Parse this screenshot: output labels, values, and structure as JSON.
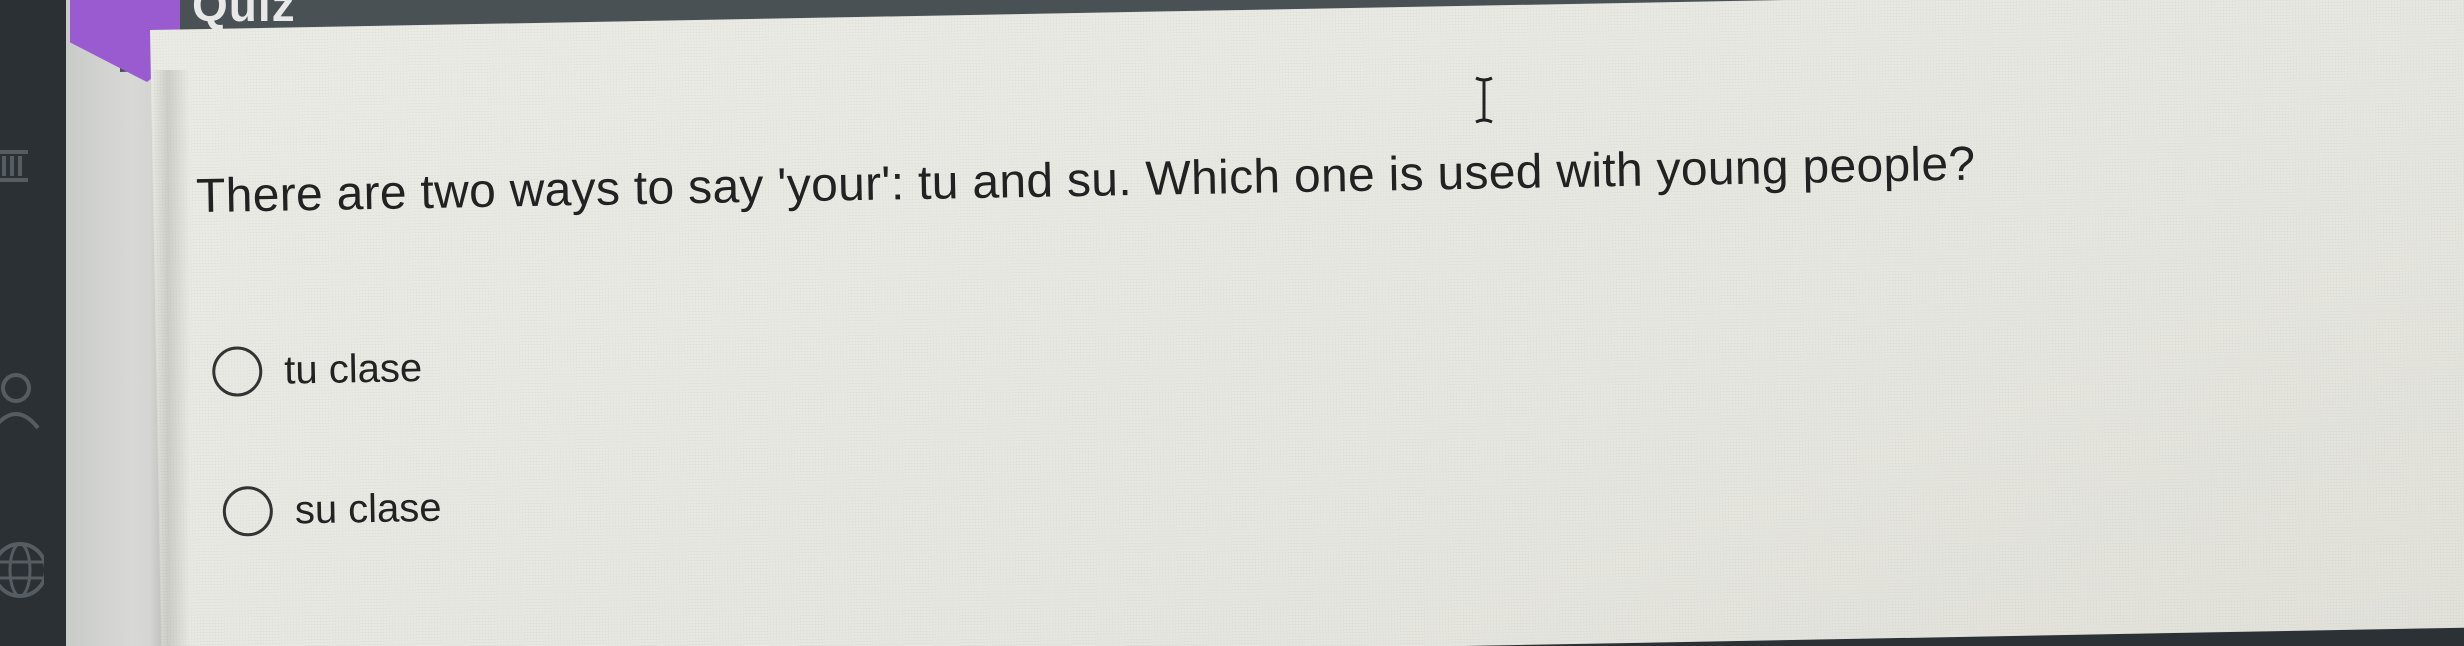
{
  "header": {
    "title": "Quiz"
  },
  "quiz": {
    "question": "There are two ways to say 'your': tu and su. Which one is used with young people?",
    "options": [
      {
        "label": "tu clase",
        "selected": false
      },
      {
        "label": "su clase",
        "selected": false
      }
    ]
  },
  "icons": {
    "rail": [
      "bank-icon",
      "person-icon",
      "globe-icon"
    ],
    "cursor": "text-cursor-icon"
  },
  "colors": {
    "header": "#4a5155",
    "accent": "#9b5bd0",
    "card": "#ecece6",
    "text": "#222222"
  }
}
